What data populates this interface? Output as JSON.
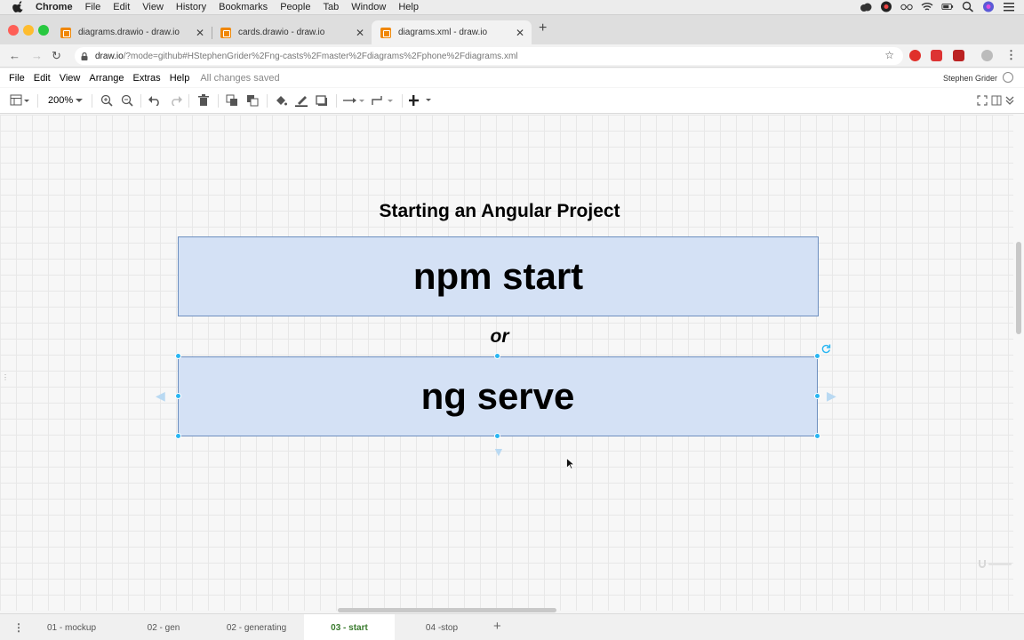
{
  "menubar": {
    "items": [
      "Chrome",
      "File",
      "Edit",
      "View",
      "History",
      "Bookmarks",
      "People",
      "Tab",
      "Window",
      "Help"
    ]
  },
  "browser": {
    "tabs": [
      {
        "title": "diagrams.drawio - draw.io"
      },
      {
        "title": "cards.drawio - draw.io"
      },
      {
        "title": "diagrams.xml - draw.io"
      }
    ],
    "url_host": "draw.io",
    "url_rest": "/?mode=github#HStephenGrider%2Fng-casts%2Fmaster%2Fdiagrams%2Fphone%2Fdiagrams.xml"
  },
  "drawio": {
    "menu": [
      "File",
      "Edit",
      "View",
      "Arrange",
      "Extras",
      "Help"
    ],
    "status": "All changes saved",
    "user": "Stephen Grider",
    "zoom": "200%"
  },
  "diagram": {
    "title": "Starting an Angular Project",
    "box1": "npm start",
    "separator": "or",
    "box2": "ng serve",
    "fill": "#d4e1f5",
    "stroke": "#6c8ebf",
    "handle_color": "#29b6f2"
  },
  "pages": [
    {
      "label": "01 - mockup"
    },
    {
      "label": "02 - gen"
    },
    {
      "label": "02 - generating"
    },
    {
      "label": "03 - start"
    },
    {
      "label": "04 -stop"
    }
  ],
  "active_page": "03 - start"
}
